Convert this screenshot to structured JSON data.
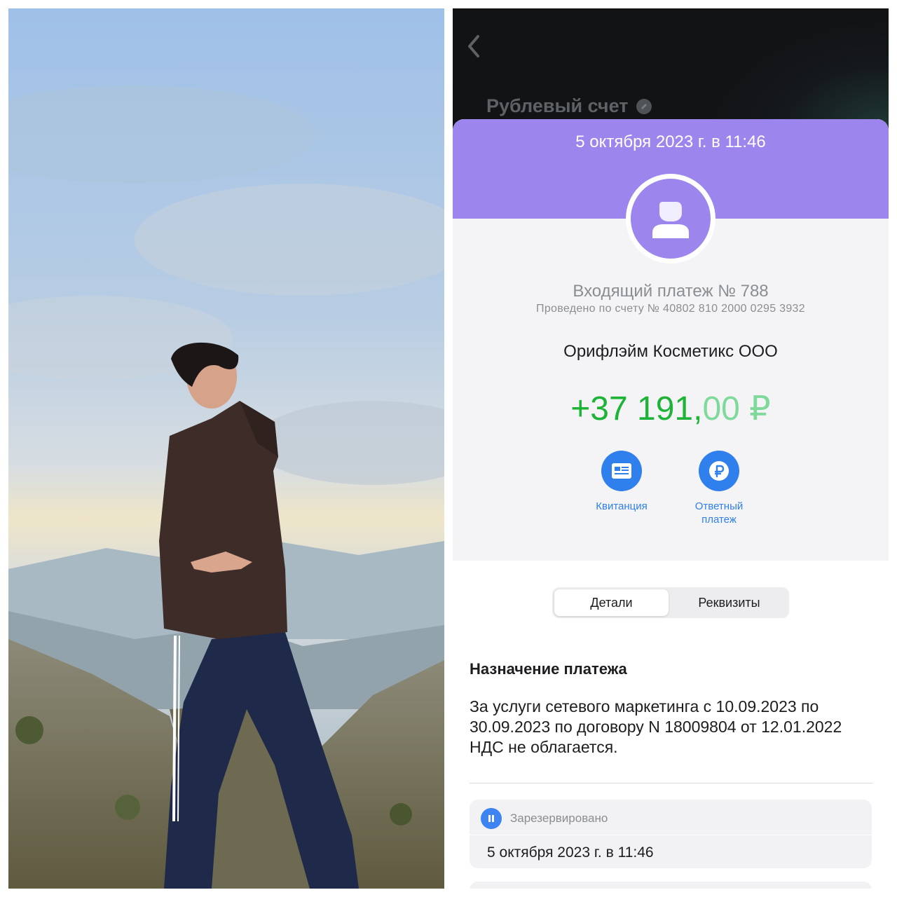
{
  "account": {
    "title": "Рублевый счет"
  },
  "payment": {
    "datetime": "5 октября 2023 г. в 11:46",
    "title": "Входящий платеж № 788",
    "account_line": "Проведено по счету № 40802 810 2000 0295 3932",
    "counterparty": "Орифлэйм Косметикс ООО",
    "amount_main": "+37 191,",
    "amount_cents": "00 ₽"
  },
  "actions": [
    {
      "label": "Квитанция",
      "icon": "receipt-icon"
    },
    {
      "label_line1": "Ответный",
      "label_line2": "платеж",
      "icon": "ruble-icon"
    }
  ],
  "tabs": {
    "details": "Детали",
    "requisites": "Реквизиты",
    "active": "details"
  },
  "purpose": {
    "title": "Назначение платежа",
    "text": "За услуги сетевого маркетинга с 10.09.2023 по 30.09.2023 по договору N 18009804 от 12.01.2022 НДС не облагается."
  },
  "status": {
    "label": "Зарезервировано",
    "date": "5 октября 2023 г. в 11:46",
    "icon": "pause-icon"
  },
  "colors": {
    "accent_purple": "#9c86ee",
    "amount_green": "#1db336",
    "action_blue": "#2f80ed",
    "dark_header": "#111315"
  }
}
